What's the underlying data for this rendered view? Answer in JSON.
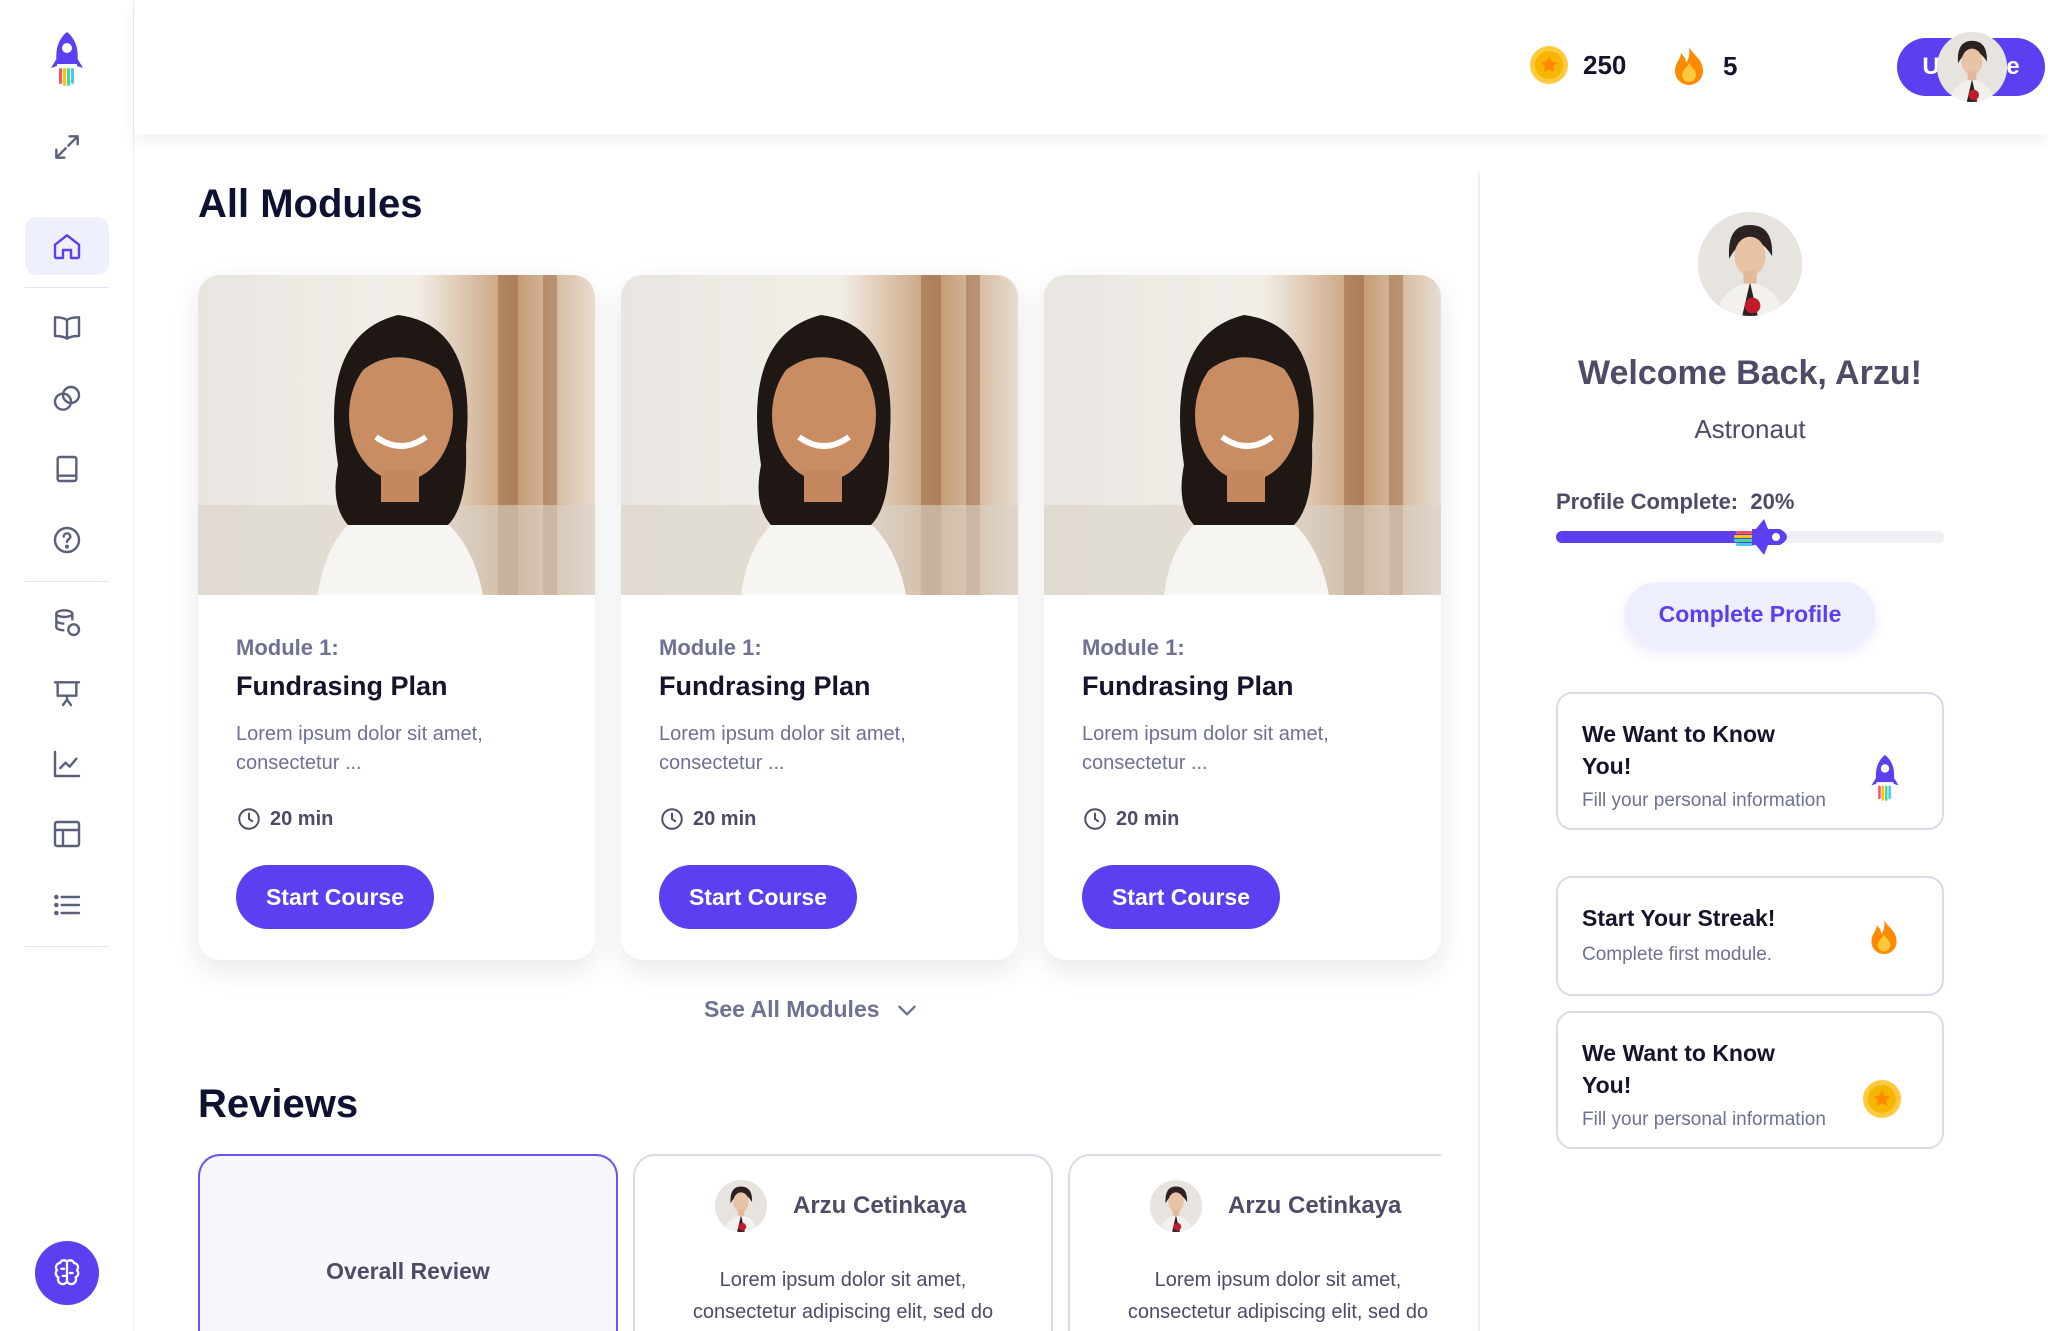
{
  "header": {
    "coins": "250",
    "streak": "5",
    "upgrade_label": "Upgrade"
  },
  "sidebar": {
    "items": [
      {
        "icon": "expand-icon"
      },
      {
        "icon": "home-icon",
        "active": true
      },
      {
        "icon": "book-open-icon"
      },
      {
        "icon": "circles-icon"
      },
      {
        "icon": "notebook-icon"
      },
      {
        "icon": "help-icon"
      },
      {
        "icon": "coins-icon"
      },
      {
        "icon": "presentation-icon"
      },
      {
        "icon": "chart-line-icon"
      },
      {
        "icon": "layout-icon"
      },
      {
        "icon": "list-icon"
      },
      {
        "icon": "brain-icon"
      }
    ]
  },
  "main": {
    "modules_title": "All Modules",
    "modules": [
      {
        "module": "Module 1:",
        "title": "Fundrasing Plan",
        "desc": "Lorem ipsum dolor sit amet, consectetur ...",
        "duration": "20 min",
        "button": "Start Course"
      },
      {
        "module": "Module 1:",
        "title": "Fundrasing Plan",
        "desc": "Lorem ipsum dolor sit amet, consectetur ...",
        "duration": "20 min",
        "button": "Start Course"
      },
      {
        "module": "Module 1:",
        "title": "Fundrasing Plan",
        "desc": "Lorem ipsum dolor sit amet, consectetur ...",
        "duration": "20 min",
        "button": "Start Course"
      }
    ],
    "see_all_label": "See All Modules",
    "reviews_title": "Reviews",
    "overall_label": "Overall Review",
    "reviews": [
      {
        "name": "Arzu Cetinkaya",
        "line1": "Lorem ipsum dolor sit amet,",
        "line2": "consectetur adipiscing elit, sed do"
      },
      {
        "name": "Arzu Cetinkaya",
        "line1": "Lorem ipsum dolor sit amet,",
        "line2": "consectetur adipiscing elit, sed do"
      }
    ]
  },
  "right": {
    "welcome": "Welcome Back, Arzu!",
    "role": "Astronaut",
    "profile_label": "Profile Complete:",
    "profile_value": "20%",
    "profile_fraction": 0.2,
    "complete_button": "Complete Profile",
    "tasks": [
      {
        "title": "We Want to Know You!",
        "subtitle": "Fill your personal information",
        "icon": "rocket-icon"
      },
      {
        "title": "Start Your Streak!",
        "subtitle": "Complete first module.",
        "icon": "fire-icon"
      },
      {
        "title": "We Want to Know You!",
        "subtitle": "Fill your personal information",
        "icon": "coin-icon"
      }
    ]
  },
  "colors": {
    "accent": "#5b3ff0",
    "accent_soft": "#eeeffd",
    "text_dark": "#14142b",
    "text_muted": "#6e7191",
    "coin": "#f7b500",
    "fire": "#ff8a00"
  }
}
